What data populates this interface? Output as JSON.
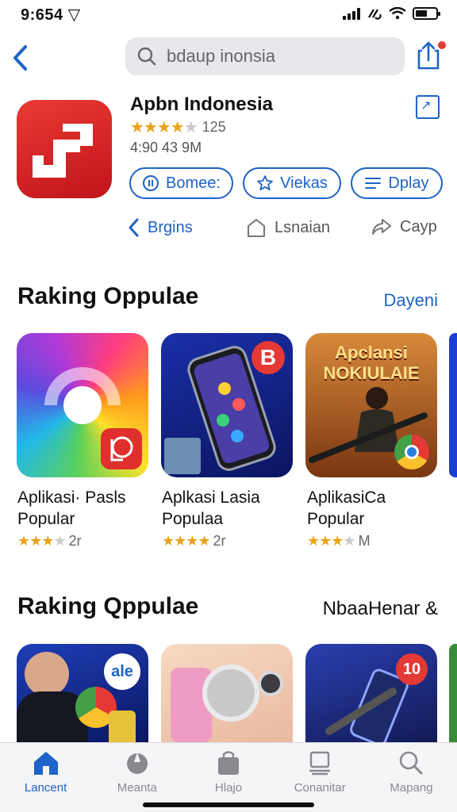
{
  "status": {
    "time": "9:654 ▽"
  },
  "search": {
    "placeholder": "bdaup inonsia"
  },
  "app": {
    "title": "Apbn Indonesia",
    "stars": 4,
    "rating_count": "125",
    "meta": "4:90 43 9M",
    "icon_color": "#d7262b"
  },
  "pills": [
    {
      "label": "Bomee:",
      "icon": "circle-icon"
    },
    {
      "label": "Viekas",
      "icon": "star-icon"
    },
    {
      "label": "Dplay",
      "icon": "list-icon"
    }
  ],
  "actions": [
    {
      "label": "Brgins",
      "icon": "chevron-left-icon"
    },
    {
      "label": "Lsnaian",
      "icon": "house-icon"
    },
    {
      "label": "Cayp",
      "icon": "share-arrow-icon"
    }
  ],
  "section1": {
    "title": "Raking Oppulae",
    "link": "Dayeni",
    "cards": [
      {
        "line1": "Aplikasi· Pasls",
        "line2": "Popular",
        "stars": 3,
        "rating": "2r"
      },
      {
        "line1": "Aplkasi Lasia",
        "line2": "Populaa",
        "stars": 4,
        "rating": "2r"
      },
      {
        "line1": "AplikasiCa",
        "line2": "Popular",
        "stars": 3,
        "rating": "M",
        "art_text_1": "Apclansi",
        "art_text_2": "NOKIULAIE"
      }
    ]
  },
  "section2": {
    "title": "Raking Qppulae",
    "link": "NbaaHenar &",
    "card_badge_1": "ale",
    "card_badge_3": "10"
  },
  "tabs": [
    {
      "label": "Lancent",
      "icon": "home-icon",
      "active": true
    },
    {
      "label": "Meanta",
      "icon": "rocket-icon",
      "active": false
    },
    {
      "label": "Hlajo",
      "icon": "bag-icon",
      "active": false
    },
    {
      "label": "Conanitar",
      "icon": "layers-icon",
      "active": false
    },
    {
      "label": "Mapang",
      "icon": "search-icon",
      "active": false
    }
  ],
  "colors": {
    "accent": "#1e63c7",
    "star": "#e8a21b",
    "badge_red": "#e53935"
  }
}
